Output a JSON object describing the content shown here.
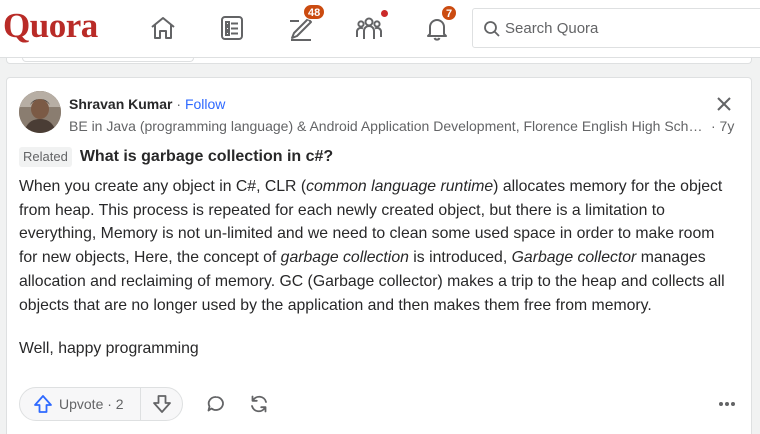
{
  "brand": {
    "logo": "Quora",
    "color": "#b92b27"
  },
  "nav": {
    "home_icon": "home-icon",
    "following_icon": "following-list-icon",
    "answer_icon": "pencil-answer-icon",
    "answer_badge": "48",
    "spaces_icon": "spaces-people-icon",
    "notifications_icon": "bell-icon",
    "notifications_badge": "7"
  },
  "search": {
    "placeholder": "Search Quora"
  },
  "post": {
    "author": "Shravan Kumar",
    "separator": " · ",
    "follow_label": "Follow",
    "credential": "BE in Java (programming language) & Android Application Development, Florence English High School",
    "age": "· 7y",
    "related_label": "Related",
    "question": "What is garbage collection in c#?",
    "p1": {
      "a": "When you create any object in C#, CLR (",
      "b": "common language runtime",
      "c": ") allocates memory for the object from heap. This process is repeated for each newly created object, but there is a limitation to everything, Memory is not un-limited and we need to clean some used space in order to make room for new objects, Here, the concept of ",
      "d": "garbage collection",
      "e": " is introduced, ",
      "f": "Garbage collector",
      "g": " manages allocation and reclaiming of memory. GC (Garbage collector) makes a trip to the heap and collects all objects that are no longer used by the application and then makes them free from memory."
    },
    "p2": "Well, happy programming",
    "upvote_label": "Upvote · 2"
  },
  "colors": {
    "accent": "#2e69ff",
    "badge": "#cb4b10",
    "text": "#282829",
    "muted": "#636466"
  }
}
